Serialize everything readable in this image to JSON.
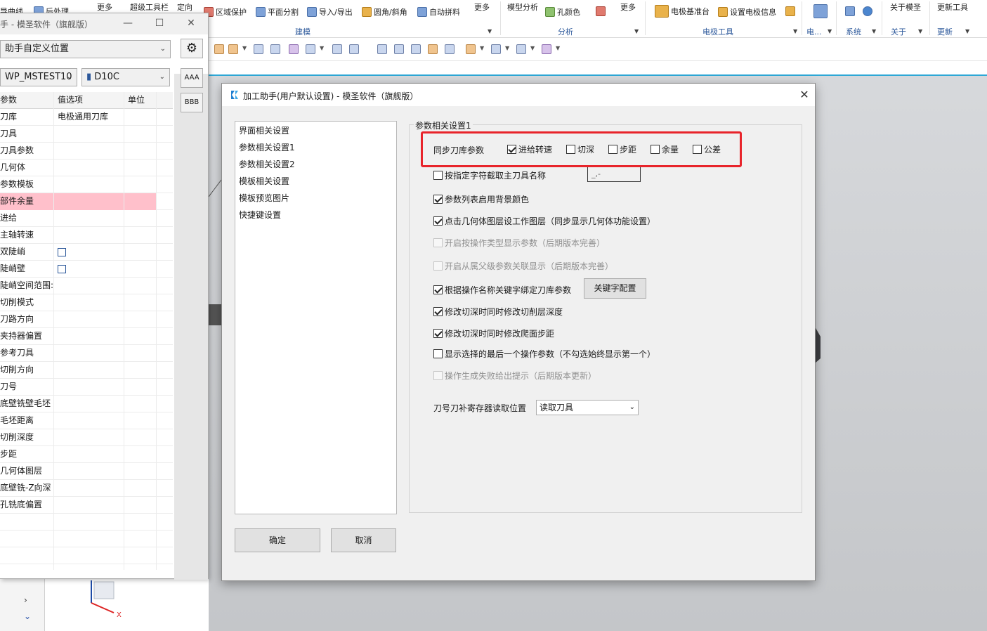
{
  "ribbon": {
    "items": [
      {
        "id": "guide-curve",
        "label": "导曲线"
      },
      {
        "id": "post-process",
        "label": "后处理"
      },
      {
        "id": "more1",
        "label": "更多"
      },
      {
        "id": "super-toolbar",
        "label": "超级工具栏"
      },
      {
        "id": "orient",
        "label": "定向"
      },
      {
        "id": "region-protect",
        "label": "区域保护"
      },
      {
        "id": "plane-split",
        "label": "平面分割"
      },
      {
        "id": "import-export",
        "label": "导入/导出"
      },
      {
        "id": "fillet-chamfer",
        "label": "圆角/斜角"
      },
      {
        "id": "auto-unpack",
        "label": "自动拼料"
      },
      {
        "id": "more2",
        "label": "更多"
      },
      {
        "id": "model-analysis",
        "label": "模型分析"
      },
      {
        "id": "hole-color",
        "label": "孔颜色"
      },
      {
        "id": "more3",
        "label": "更多"
      },
      {
        "id": "electrode-base",
        "label": "电极基准台"
      },
      {
        "id": "set-electrode-info",
        "label": "设置电极信息"
      },
      {
        "id": "about-mosheng",
        "label": "关于模圣"
      },
      {
        "id": "update-tool",
        "label": "更新工具"
      }
    ],
    "groups": [
      "建模",
      "分析",
      "电极工具",
      "电...",
      "系统",
      "关于",
      "更新"
    ]
  },
  "assist": {
    "title": "手 - 模圣软件（旗舰版）",
    "position_combo": "助手自定义位置",
    "wp_combo": "WP_MSTEST10",
    "tool_combo": "D10C",
    "btn_aaa": "AAA",
    "btn_bbb": "BBB",
    "columns": [
      "参数",
      "值选项",
      "单位"
    ],
    "rows": [
      {
        "p": "刀库",
        "v": "电极通用刀库",
        "u": "",
        "hl": false,
        "cb": false
      },
      {
        "p": "刀具",
        "v": "",
        "u": "",
        "hl": false,
        "cb": false
      },
      {
        "p": "刀具参数",
        "v": "",
        "u": "",
        "hl": false,
        "cb": false
      },
      {
        "p": "几何体",
        "v": "",
        "u": "",
        "hl": false,
        "cb": false
      },
      {
        "p": "参数模板",
        "v": "",
        "u": "",
        "hl": false,
        "cb": false
      },
      {
        "p": "部件余量",
        "v": "",
        "u": "",
        "hl": true,
        "cb": false
      },
      {
        "p": "进给",
        "v": "",
        "u": "",
        "hl": false,
        "cb": false
      },
      {
        "p": "主轴转速",
        "v": "",
        "u": "",
        "hl": false,
        "cb": false
      },
      {
        "p": "双陡峭",
        "v": "",
        "u": "",
        "hl": false,
        "cb": true
      },
      {
        "p": "陡峭壁",
        "v": "",
        "u": "",
        "hl": false,
        "cb": true
      },
      {
        "p": "陡峭空间范围:",
        "v": "",
        "u": "",
        "hl": false,
        "cb": false
      },
      {
        "p": "切削模式",
        "v": "",
        "u": "",
        "hl": false,
        "cb": false
      },
      {
        "p": "刀路方向",
        "v": "",
        "u": "",
        "hl": false,
        "cb": false
      },
      {
        "p": "夹持器偏置",
        "v": "",
        "u": "",
        "hl": false,
        "cb": false
      },
      {
        "p": "参考刀具",
        "v": "",
        "u": "",
        "hl": false,
        "cb": false
      },
      {
        "p": "切削方向",
        "v": "",
        "u": "",
        "hl": false,
        "cb": false
      },
      {
        "p": "刀号",
        "v": "",
        "u": "",
        "hl": false,
        "cb": false
      },
      {
        "p": "底壁铣壁毛坯",
        "v": "",
        "u": "",
        "hl": false,
        "cb": false
      },
      {
        "p": "毛坯距离",
        "v": "",
        "u": "",
        "hl": false,
        "cb": false
      },
      {
        "p": "切削深度",
        "v": "",
        "u": "",
        "hl": false,
        "cb": false
      },
      {
        "p": "步距",
        "v": "",
        "u": "",
        "hl": false,
        "cb": false
      },
      {
        "p": "几何体图层",
        "v": "",
        "u": "",
        "hl": false,
        "cb": false
      },
      {
        "p": "底壁铣-Z向深",
        "v": "",
        "u": "",
        "hl": false,
        "cb": false
      },
      {
        "p": "孔铣底偏置",
        "v": "",
        "u": "",
        "hl": false,
        "cb": false
      },
      {
        "p": "",
        "v": "",
        "u": "",
        "hl": false,
        "cb": false
      },
      {
        "p": "",
        "v": "",
        "u": "",
        "hl": false,
        "cb": false
      },
      {
        "p": "",
        "v": "",
        "u": "",
        "hl": false,
        "cb": false
      },
      {
        "p": "",
        "v": "",
        "u": "",
        "hl": false,
        "cb": false
      }
    ]
  },
  "dialog": {
    "title": "加工助手(用户默认设置) - 模圣软件（旗舰版）",
    "nav": [
      "界面相关设置",
      "参数相关设置1",
      "参数相关设置2",
      "模板相关设置",
      "模板预览图片",
      "快捷键设置"
    ],
    "group_title": "参数相关设置1",
    "sync_label": "同步刀库参数",
    "sync_options": [
      {
        "label": "进给转速",
        "checked": true
      },
      {
        "label": "切深",
        "checked": false
      },
      {
        "label": "步距",
        "checked": false
      },
      {
        "label": "余量",
        "checked": false
      },
      {
        "label": "公差",
        "checked": false
      }
    ],
    "options": [
      {
        "label": "按指定字符截取主刀具名称",
        "checked": false,
        "disabled": false
      },
      {
        "label": "参数列表启用背景颜色",
        "checked": true,
        "disabled": false
      },
      {
        "label": "点击几何体图层设工作图层（同步显示几何体功能设置）",
        "checked": true,
        "disabled": false
      },
      {
        "label": "开启按操作类型显示参数（后期版本完善）",
        "checked": false,
        "disabled": true
      },
      {
        "label": "开启从属父级参数关联显示（后期版本完善）",
        "checked": false,
        "disabled": true
      },
      {
        "label": "根据操作名称关键字绑定刀库参数",
        "checked": true,
        "disabled": false
      },
      {
        "label": "修改切深时同时修改切削层深度",
        "checked": true,
        "disabled": false
      },
      {
        "label": "修改切深时同时修改爬面步距",
        "checked": true,
        "disabled": false
      },
      {
        "label": "显示选择的最后一个操作参数（不勾选始终显示第一个）",
        "checked": false,
        "disabled": false
      },
      {
        "label": "操作生成失败给出提示（后期版本更新）",
        "checked": false,
        "disabled": true
      }
    ],
    "char_input_value": "_,-",
    "keyword_button": "关键字配置",
    "tool_reg_label": "刀号刀补寄存器读取位置",
    "tool_reg_value": "读取刀具",
    "ok": "确定",
    "cancel": "取消"
  },
  "colors": {
    "highlight_row": "#ffc0cb",
    "annotation_box": "#e8242b",
    "accent": "#2b579a"
  }
}
